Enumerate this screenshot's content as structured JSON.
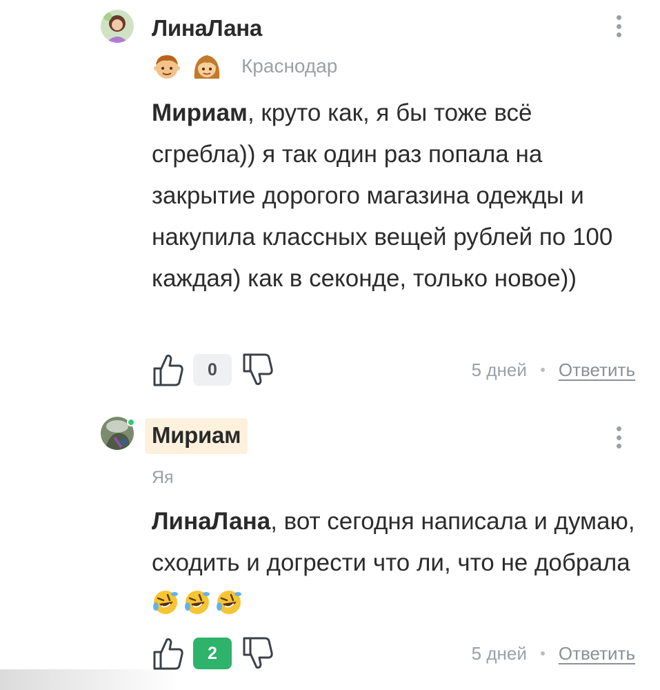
{
  "comments": [
    {
      "author": "ЛинаЛана",
      "location": "Краснодар",
      "mention": "Мириам",
      "text": ", круто как, я бы тоже всё сгребла)) я так один раз попала на закрытие дорогого магазина одежды и накупила классных вещей рублей по 100 каждая) как в секонде, только новое))",
      "rating": "0",
      "time": "5 дней",
      "reply_label": "Ответить",
      "kid_icons": [
        "boy-face-icon",
        "girl-face-icon"
      ]
    },
    {
      "author": "Мириам",
      "badge": "Яя",
      "mention": "ЛинаЛана",
      "text": ", вот сегодня написала и думаю, сходить и догрести что ли, что не добрала",
      "emojis": [
        "rolling-laughing-icon",
        "rolling-laughing-icon",
        "rolling-laughing-icon"
      ],
      "rating": "2",
      "time": "5 дней",
      "reply_label": "Ответить",
      "online": true
    }
  ],
  "colors": {
    "accent_positive": "#2db36a",
    "author_highlight": "#fdf1dd",
    "muted_text": "#9aa0a6",
    "online": "#2ecc71"
  }
}
